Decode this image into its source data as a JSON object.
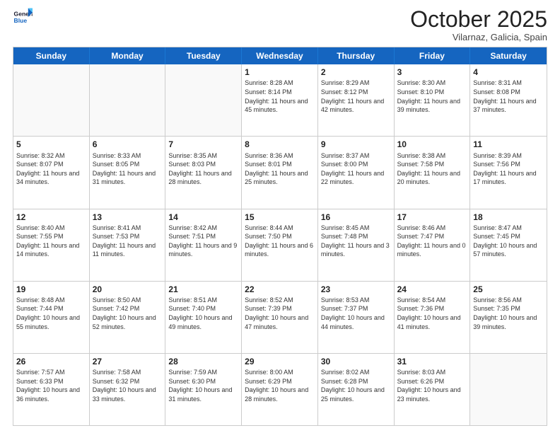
{
  "header": {
    "logo_general": "General",
    "logo_blue": "Blue",
    "month_title": "October 2025",
    "subtitle": "Vilarnaz, Galicia, Spain"
  },
  "weekdays": [
    "Sunday",
    "Monday",
    "Tuesday",
    "Wednesday",
    "Thursday",
    "Friday",
    "Saturday"
  ],
  "rows": [
    [
      {
        "day": "",
        "empty": true
      },
      {
        "day": "",
        "empty": true
      },
      {
        "day": "",
        "empty": true
      },
      {
        "day": "1",
        "sunrise": "8:28 AM",
        "sunset": "8:14 PM",
        "daylight": "11 hours and 45 minutes."
      },
      {
        "day": "2",
        "sunrise": "8:29 AM",
        "sunset": "8:12 PM",
        "daylight": "11 hours and 42 minutes."
      },
      {
        "day": "3",
        "sunrise": "8:30 AM",
        "sunset": "8:10 PM",
        "daylight": "11 hours and 39 minutes."
      },
      {
        "day": "4",
        "sunrise": "8:31 AM",
        "sunset": "8:08 PM",
        "daylight": "11 hours and 37 minutes."
      }
    ],
    [
      {
        "day": "5",
        "sunrise": "8:32 AM",
        "sunset": "8:07 PM",
        "daylight": "11 hours and 34 minutes."
      },
      {
        "day": "6",
        "sunrise": "8:33 AM",
        "sunset": "8:05 PM",
        "daylight": "11 hours and 31 minutes."
      },
      {
        "day": "7",
        "sunrise": "8:35 AM",
        "sunset": "8:03 PM",
        "daylight": "11 hours and 28 minutes."
      },
      {
        "day": "8",
        "sunrise": "8:36 AM",
        "sunset": "8:01 PM",
        "daylight": "11 hours and 25 minutes."
      },
      {
        "day": "9",
        "sunrise": "8:37 AM",
        "sunset": "8:00 PM",
        "daylight": "11 hours and 22 minutes."
      },
      {
        "day": "10",
        "sunrise": "8:38 AM",
        "sunset": "7:58 PM",
        "daylight": "11 hours and 20 minutes."
      },
      {
        "day": "11",
        "sunrise": "8:39 AM",
        "sunset": "7:56 PM",
        "daylight": "11 hours and 17 minutes."
      }
    ],
    [
      {
        "day": "12",
        "sunrise": "8:40 AM",
        "sunset": "7:55 PM",
        "daylight": "11 hours and 14 minutes."
      },
      {
        "day": "13",
        "sunrise": "8:41 AM",
        "sunset": "7:53 PM",
        "daylight": "11 hours and 11 minutes."
      },
      {
        "day": "14",
        "sunrise": "8:42 AM",
        "sunset": "7:51 PM",
        "daylight": "11 hours and 9 minutes."
      },
      {
        "day": "15",
        "sunrise": "8:44 AM",
        "sunset": "7:50 PM",
        "daylight": "11 hours and 6 minutes."
      },
      {
        "day": "16",
        "sunrise": "8:45 AM",
        "sunset": "7:48 PM",
        "daylight": "11 hours and 3 minutes."
      },
      {
        "day": "17",
        "sunrise": "8:46 AM",
        "sunset": "7:47 PM",
        "daylight": "11 hours and 0 minutes."
      },
      {
        "day": "18",
        "sunrise": "8:47 AM",
        "sunset": "7:45 PM",
        "daylight": "10 hours and 57 minutes."
      }
    ],
    [
      {
        "day": "19",
        "sunrise": "8:48 AM",
        "sunset": "7:44 PM",
        "daylight": "10 hours and 55 minutes."
      },
      {
        "day": "20",
        "sunrise": "8:50 AM",
        "sunset": "7:42 PM",
        "daylight": "10 hours and 52 minutes."
      },
      {
        "day": "21",
        "sunrise": "8:51 AM",
        "sunset": "7:40 PM",
        "daylight": "10 hours and 49 minutes."
      },
      {
        "day": "22",
        "sunrise": "8:52 AM",
        "sunset": "7:39 PM",
        "daylight": "10 hours and 47 minutes."
      },
      {
        "day": "23",
        "sunrise": "8:53 AM",
        "sunset": "7:37 PM",
        "daylight": "10 hours and 44 minutes."
      },
      {
        "day": "24",
        "sunrise": "8:54 AM",
        "sunset": "7:36 PM",
        "daylight": "10 hours and 41 minutes."
      },
      {
        "day": "25",
        "sunrise": "8:56 AM",
        "sunset": "7:35 PM",
        "daylight": "10 hours and 39 minutes."
      }
    ],
    [
      {
        "day": "26",
        "sunrise": "7:57 AM",
        "sunset": "6:33 PM",
        "daylight": "10 hours and 36 minutes."
      },
      {
        "day": "27",
        "sunrise": "7:58 AM",
        "sunset": "6:32 PM",
        "daylight": "10 hours and 33 minutes."
      },
      {
        "day": "28",
        "sunrise": "7:59 AM",
        "sunset": "6:30 PM",
        "daylight": "10 hours and 31 minutes."
      },
      {
        "day": "29",
        "sunrise": "8:00 AM",
        "sunset": "6:29 PM",
        "daylight": "10 hours and 28 minutes."
      },
      {
        "day": "30",
        "sunrise": "8:02 AM",
        "sunset": "6:28 PM",
        "daylight": "10 hours and 25 minutes."
      },
      {
        "day": "31",
        "sunrise": "8:03 AM",
        "sunset": "6:26 PM",
        "daylight": "10 hours and 23 minutes."
      },
      {
        "day": "",
        "empty": true
      }
    ]
  ]
}
